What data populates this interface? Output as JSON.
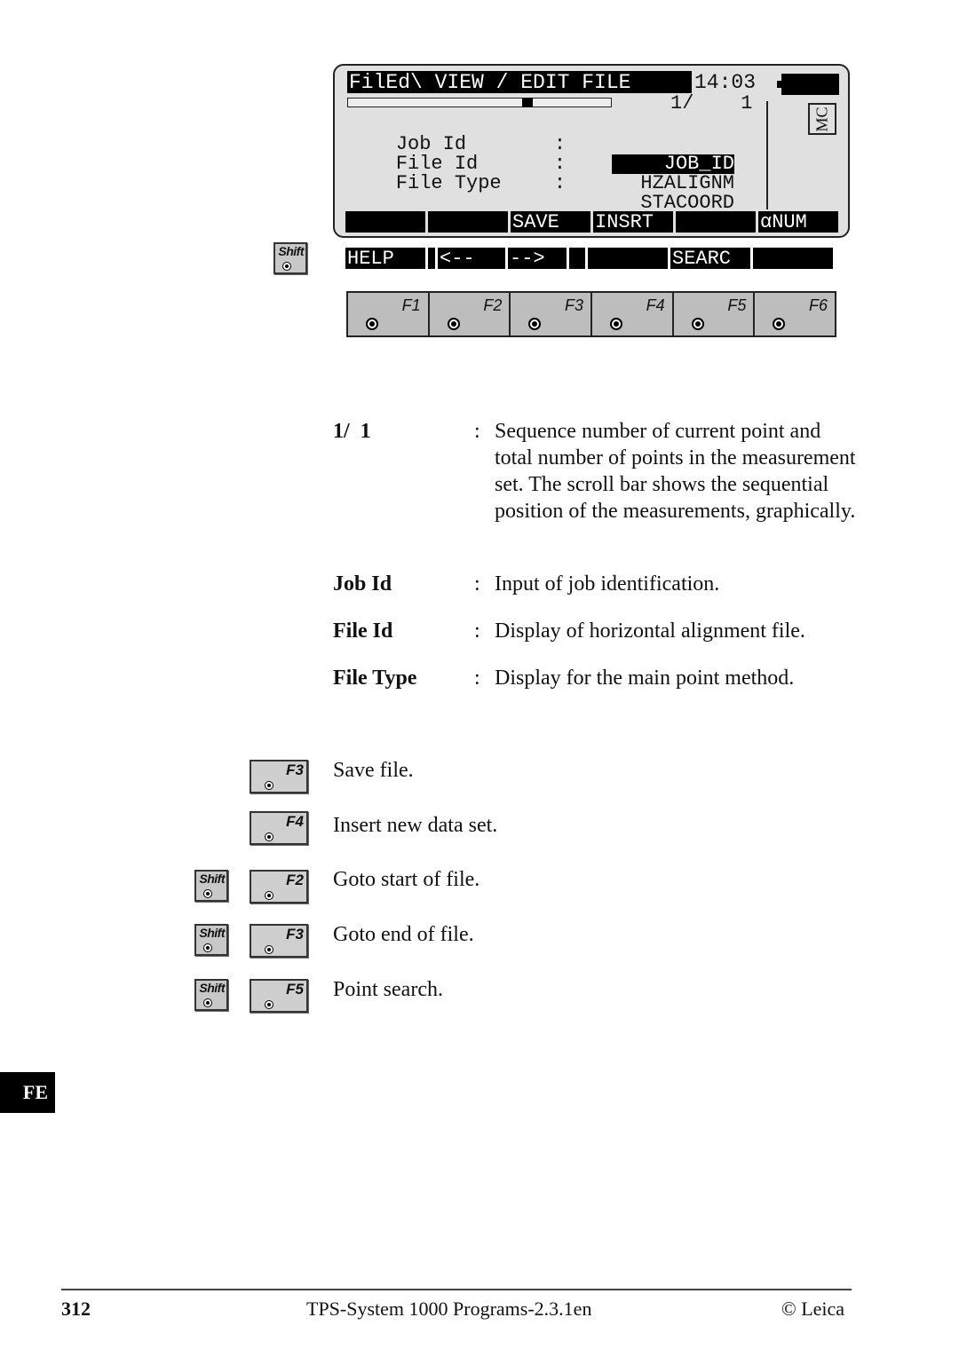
{
  "screen": {
    "title": "FilEd\\ VIEW / EDIT FILE",
    "clock": "14:03",
    "counter": "1/    1",
    "scroll_position": 0.69,
    "mode_badge": "MC",
    "fields": [
      {
        "label": "Job Id",
        "colon": ":",
        "value": "JOB_ID",
        "active": true
      },
      {
        "label": "File Id",
        "colon": ":",
        "value": "HZALIGNM",
        "active": false
      },
      {
        "label": "File Type",
        "colon": ":",
        "value": "STACOORD",
        "active": false
      }
    ],
    "softkeys": [
      "",
      "",
      "SAVE",
      "INSRT",
      "",
      "αNUM"
    ],
    "shift_softkeys": [
      "HELP",
      "",
      "<--",
      "-->",
      "",
      "",
      "SEARC",
      ""
    ]
  },
  "shift_key_label": "Shift",
  "function_keys": [
    "F1",
    "F2",
    "F3",
    "F4",
    "F5",
    "F6"
  ],
  "descriptions": [
    {
      "term": "1/  1",
      "colon": ":",
      "text": "Sequence number of current point and total number of points in the measurement set. The scroll bar shows the sequential position of the measurements, graphically."
    },
    {
      "term": "Job Id",
      "colon": ":",
      "text": "Input of job identification."
    },
    {
      "term": "File Id",
      "colon": ":",
      "text": "Display of horizontal alignment file."
    },
    {
      "term": "File Type",
      "colon": ":",
      "text": "Display for the main point method."
    }
  ],
  "key_actions": [
    {
      "shift": false,
      "key": "F3",
      "text": "Save file."
    },
    {
      "shift": false,
      "key": "F4",
      "text": "Insert new data set."
    },
    {
      "shift": true,
      "key": "F2",
      "text": "Goto start of file."
    },
    {
      "shift": true,
      "key": "F3",
      "text": "Goto end of file."
    },
    {
      "shift": true,
      "key": "F5",
      "text": "Point search."
    }
  ],
  "side_tab": "FE",
  "footer": {
    "page_number": "312",
    "title": "TPS-System 1000 Programs-2.3.1en",
    "copyright": "© Leica"
  }
}
